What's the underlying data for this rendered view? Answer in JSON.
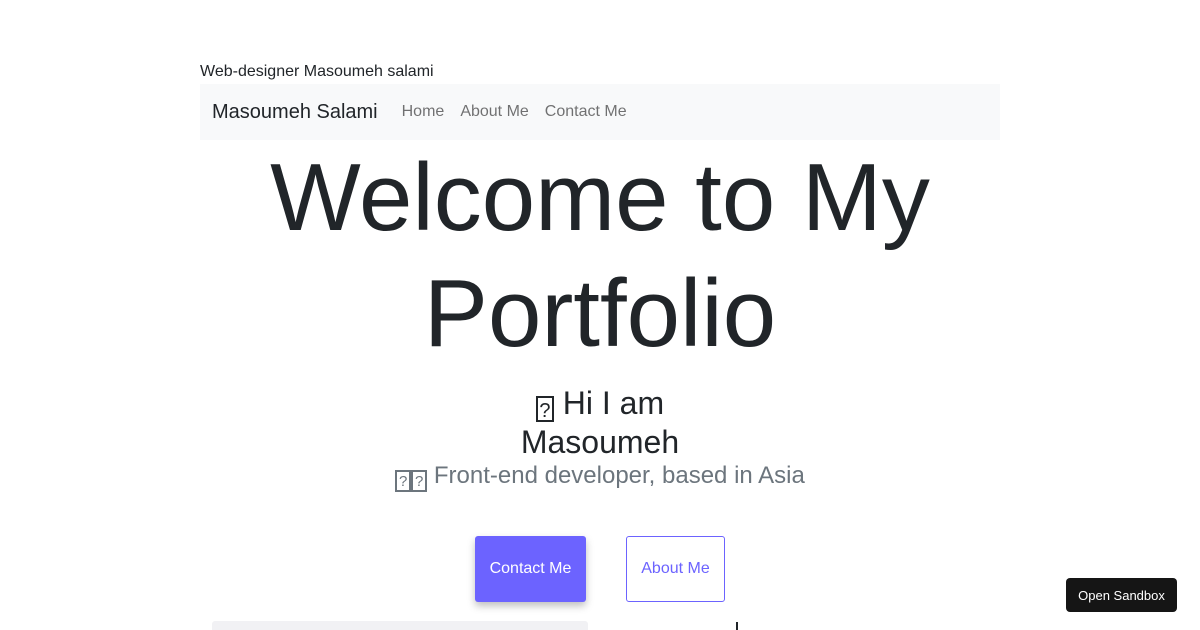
{
  "page": {
    "top_title": "Web-designer Masoumeh salami"
  },
  "navbar": {
    "brand": "Masoumeh Salami",
    "links": [
      "Home",
      "About Me",
      "Contact Me"
    ]
  },
  "hero": {
    "title": "Welcome to My Portfolio",
    "greeting_glyph": "?",
    "greeting": "Hi I am",
    "name": "Masoumeh",
    "role_glyphs": [
      "?",
      "?"
    ],
    "role": "Front-end developer, based in Asia"
  },
  "buttons": {
    "contact": "Contact Me",
    "about": "About Me"
  },
  "sandbox": {
    "label": "Open Sandbox"
  },
  "colors": {
    "accent": "#6c63ff",
    "navbar_bg": "#f8f9fa",
    "text": "#212529",
    "muted": "#6c757d",
    "sandbox_bg": "#151515"
  }
}
